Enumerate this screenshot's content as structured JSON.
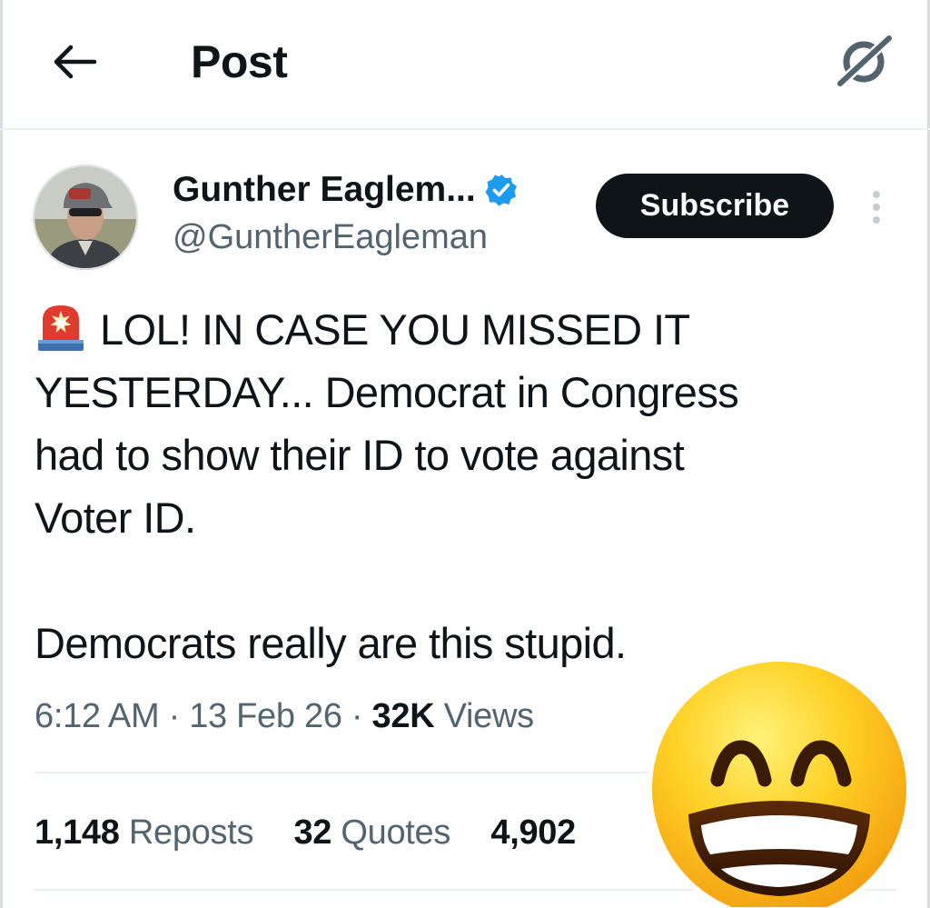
{
  "header": {
    "back_icon": "arrow-left-icon",
    "title": "Post",
    "grok_icon": "grok-icon"
  },
  "author": {
    "display_name": "Gunther Eaglem...",
    "handle": "@GuntherEagleman",
    "verified_icon": "verified-badge-icon",
    "verified_color": "#1d9bf0",
    "subscribe_label": "Subscribe",
    "more_icon": "more-vertical-icon"
  },
  "tweet": {
    "siren_icon": "rotating-light-icon",
    "lines": [
      "LOL!  IN CASE YOU MISSED IT",
      "YESTERDAY... Democrat in Congress",
      "had to show their ID to vote against",
      "Voter ID."
    ],
    "closing": "Democrats really are this stupid."
  },
  "meta": {
    "time": "6:12 AM",
    "date": "13 Feb 26",
    "views_count": "32K",
    "views_label": "Views"
  },
  "stats": {
    "reposts_count": "1,148",
    "reposts_label": "Reposts",
    "quotes_count": "32",
    "quotes_label": "Quotes",
    "likes_count_visible": "4,902"
  },
  "overlay": {
    "emoji": "grinning-face-with-smiling-eyes-icon"
  },
  "colors": {
    "text_primary": "#0f1419",
    "text_secondary": "#536471",
    "button_bg": "#0f1419",
    "divider": "#eceff1"
  }
}
